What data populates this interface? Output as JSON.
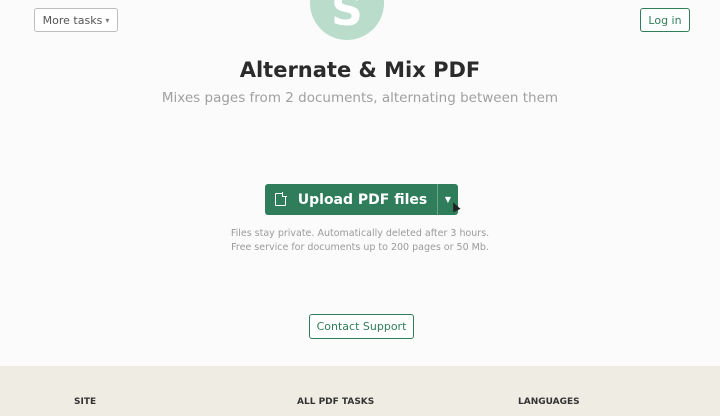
{
  "header": {
    "more_tasks_label": "More tasks",
    "login_label": "Log in"
  },
  "logo": {
    "letter": "S"
  },
  "main": {
    "title": "Alternate & Mix PDF",
    "subtitle": "Mixes pages from 2 documents, alternating between them",
    "upload_label": "Upload PDF files",
    "note_line_1": "Files stay private. Automatically deleted after 3 hours.",
    "note_line_2": "Free service for documents up to 200 pages or 50 Mb.",
    "contact_label": "Contact Support"
  },
  "footer": {
    "columns": [
      "SITE",
      "ALL PDF TASKS",
      "LANGUAGES"
    ]
  },
  "colors": {
    "brand_green": "#2f7d5a",
    "logo_mint": "#b9dccb",
    "footer_bg": "#efede3"
  },
  "icons": [
    "chevron-down-icon",
    "pdf-file-icon",
    "dropdown-caret-icon",
    "mouse-cursor-icon"
  ]
}
